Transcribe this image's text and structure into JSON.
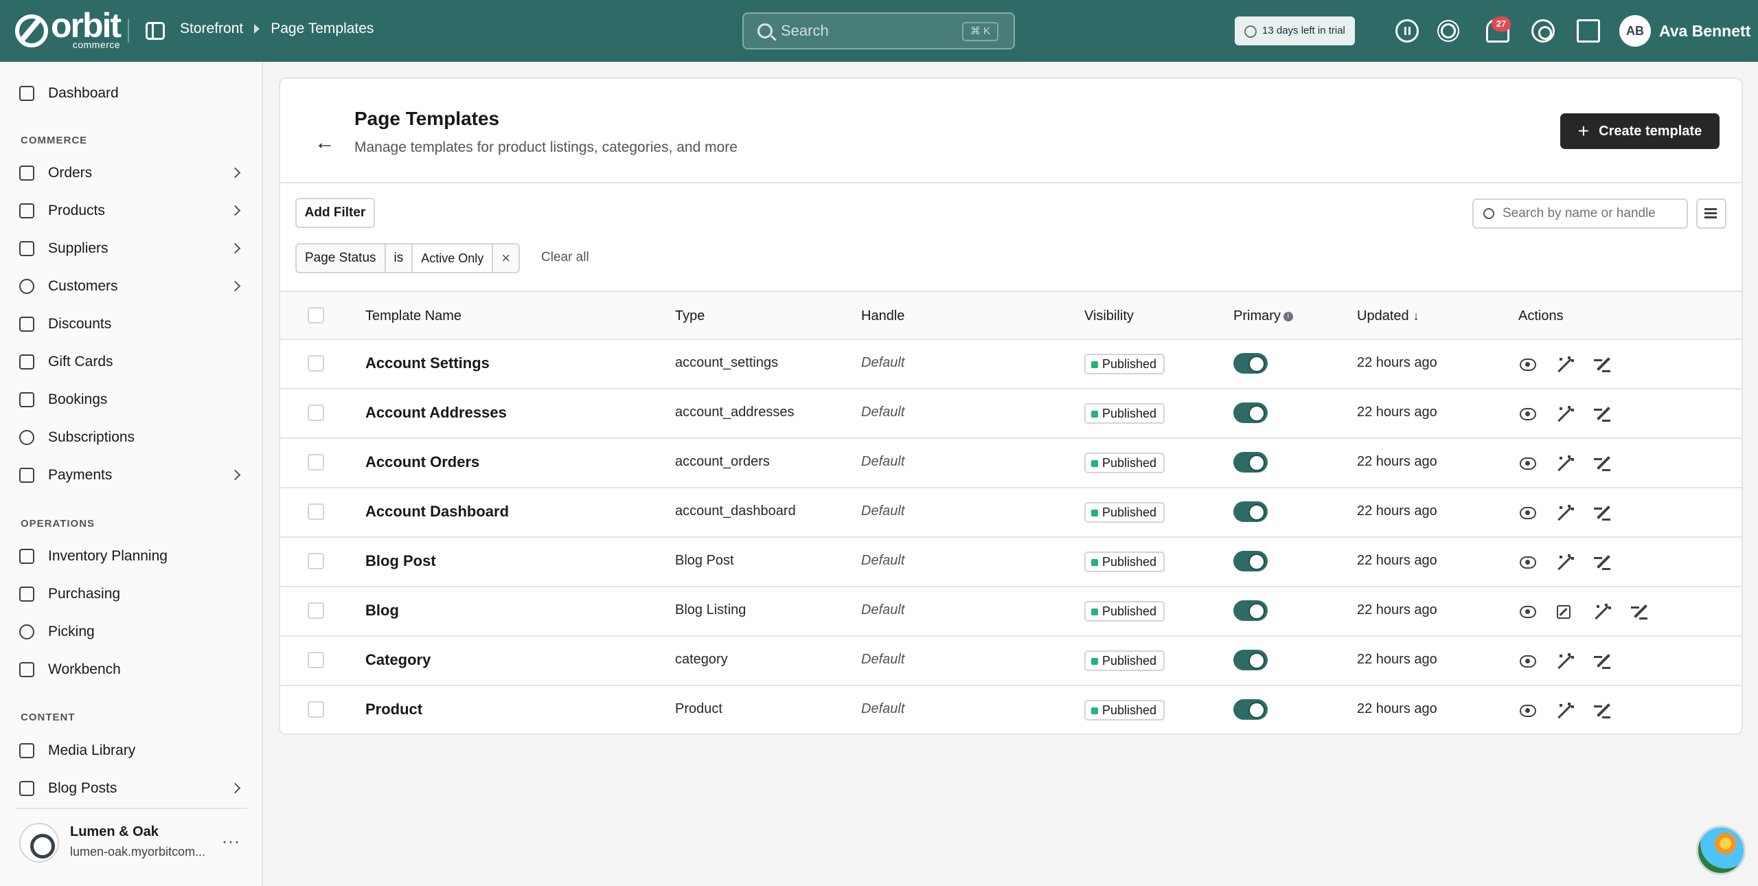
{
  "topbar": {
    "logo_word": "orbit",
    "logo_sub": "commerce",
    "breadcrumb": [
      "Storefront",
      "Page Templates"
    ],
    "search_placeholder": "Search",
    "search_shortcut": "⌘ K",
    "trial": "13 days left in trial",
    "notifications": "27",
    "user_initials": "AB",
    "user_name": "Ava Bennett"
  },
  "sidebar": {
    "dashboard": "Dashboard",
    "sections": {
      "commerce": "COMMERCE",
      "operations": "OPERATIONS",
      "content": "CONTENT"
    },
    "commerce_items": [
      {
        "label": "Orders",
        "chevron": true
      },
      {
        "label": "Products",
        "chevron": true
      },
      {
        "label": "Suppliers",
        "chevron": true
      },
      {
        "label": "Customers",
        "chevron": true
      },
      {
        "label": "Discounts",
        "chevron": false
      },
      {
        "label": "Gift Cards",
        "chevron": false
      },
      {
        "label": "Bookings",
        "chevron": false
      },
      {
        "label": "Subscriptions",
        "chevron": false
      },
      {
        "label": "Payments",
        "chevron": true
      }
    ],
    "operations_items": [
      "Inventory Planning",
      "Purchasing",
      "Picking",
      "Workbench"
    ],
    "content_items": [
      {
        "label": "Media Library",
        "chevron": false
      },
      {
        "label": "Blog Posts",
        "chevron": true
      }
    ],
    "store": {
      "name": "Lumen & Oak",
      "url": "lumen-oak.myorbitcom..."
    }
  },
  "page": {
    "title": "Page Templates",
    "subtitle": "Manage templates for product listings, categories, and more",
    "create_label": "Create template",
    "add_filter": "Add Filter",
    "search_placeholder": "Search by name or handle",
    "filter": {
      "field": "Page Status",
      "op": "is",
      "value": "Active Only",
      "remove": "×"
    },
    "clear_all": "Clear all"
  },
  "table": {
    "columns": {
      "name": "Template Name",
      "type": "Type",
      "handle": "Handle",
      "visibility": "Visibility",
      "primary": "Primary",
      "updated": "Updated",
      "actions": "Actions"
    },
    "rows": [
      {
        "name": "Account Settings",
        "type": "account_settings",
        "handle": "Default",
        "visibility": "Published",
        "primary": true,
        "updated": "22 hours ago",
        "external": false
      },
      {
        "name": "Account Addresses",
        "type": "account_addresses",
        "handle": "Default",
        "visibility": "Published",
        "primary": true,
        "updated": "22 hours ago",
        "external": false
      },
      {
        "name": "Account Orders",
        "type": "account_orders",
        "handle": "Default",
        "visibility": "Published",
        "primary": true,
        "updated": "22 hours ago",
        "external": false
      },
      {
        "name": "Account Dashboard",
        "type": "account_dashboard",
        "handle": "Default",
        "visibility": "Published",
        "primary": true,
        "updated": "22 hours ago",
        "external": false
      },
      {
        "name": "Blog Post",
        "type": "Blog Post",
        "handle": "Default",
        "visibility": "Published",
        "primary": true,
        "updated": "22 hours ago",
        "external": false
      },
      {
        "name": "Blog",
        "type": "Blog Listing",
        "handle": "Default",
        "visibility": "Published",
        "primary": true,
        "updated": "22 hours ago",
        "external": true
      },
      {
        "name": "Category",
        "type": "category",
        "handle": "Default",
        "visibility": "Published",
        "primary": true,
        "updated": "22 hours ago",
        "external": false
      },
      {
        "name": "Product",
        "type": "Product",
        "handle": "Default",
        "visibility": "Published",
        "primary": true,
        "updated": "22 hours ago",
        "external": false
      }
    ]
  },
  "colors": {
    "brand": "#2f6b66",
    "published": "#22b573",
    "badge": "#e5484d"
  }
}
